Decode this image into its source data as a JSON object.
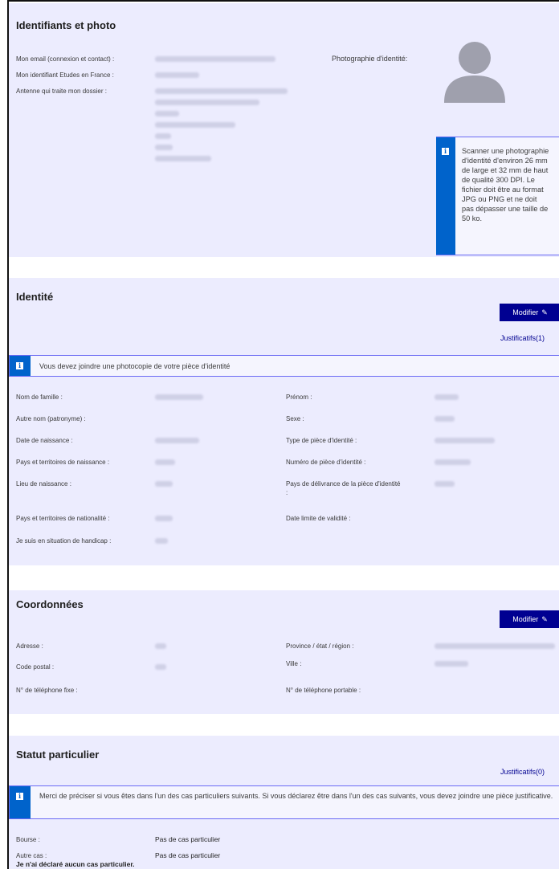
{
  "section1": {
    "title": "Identifiants et photo",
    "email_label": "Mon email (connexion et contact) :",
    "id_label": "Mon identifiant Etudes en France :",
    "antenne_label": "Antenne qui traite mon dossier :",
    "photo_label": "Photographie d'identité:",
    "photo_info": "Scanner une photographie d'identité d'environ 26 mm de large et 32 mm de haut de qualité 300 DPI. Le fichier doit être au format JPG ou PNG et ne doit pas dépasser une taille de 50 ko."
  },
  "section2": {
    "title": "Identité",
    "modify_label": "Modifier",
    "justif_label": "Justificatifs(1)",
    "info": "Vous devez joindre une photocopie de votre pièce d'identité",
    "left_labels": [
      "Nom de famille :",
      "Autre nom (patronyme) :",
      "Date de naissance :",
      "Pays et territoires de naissance :",
      "Lieu de naissance :",
      "Pays et territoires de nationalité :",
      "Je suis en situation de handicap :"
    ],
    "right_labels": [
      "Prénom :",
      "Sexe :",
      "Type de pièce d'identité :",
      "Numéro de pièce d'identité :",
      "Pays de délivrance de la pièce d'identité :",
      "Date limite de validité :"
    ]
  },
  "section3": {
    "title": "Coordonnées",
    "modify_label": "Modifier",
    "address_label": "Adresse :",
    "postal_label": "Code postal :",
    "phone_label": "N° de téléphone fixe :",
    "province_label": "Province / état / région :",
    "city_label": "Ville :",
    "mobile_label": "N° de téléphone portable :"
  },
  "section4": {
    "title": "Statut particulier",
    "justif_label": "Justificatifs(0)",
    "info": "Merci de préciser si vous êtes dans l'un des cas particuliers suivants. Si vous déclarez être dans l'un des cas suivants, vous devez joindre une pièce justificative.",
    "bourse_label": "Bourse :",
    "bourse_value": "Pas de cas particulier",
    "autre_label": "Autre cas :",
    "autre_value": "Pas de cas particulier",
    "none_declared": "Je n'ai déclaré aucun cas particulier."
  },
  "icons": {
    "info": "info-icon",
    "edit": "pencil-icon",
    "avatar": "user-avatar-icon"
  },
  "colors": {
    "primary": "#000091",
    "info_blue": "#0063cb",
    "section_bg": "#ececfe"
  }
}
